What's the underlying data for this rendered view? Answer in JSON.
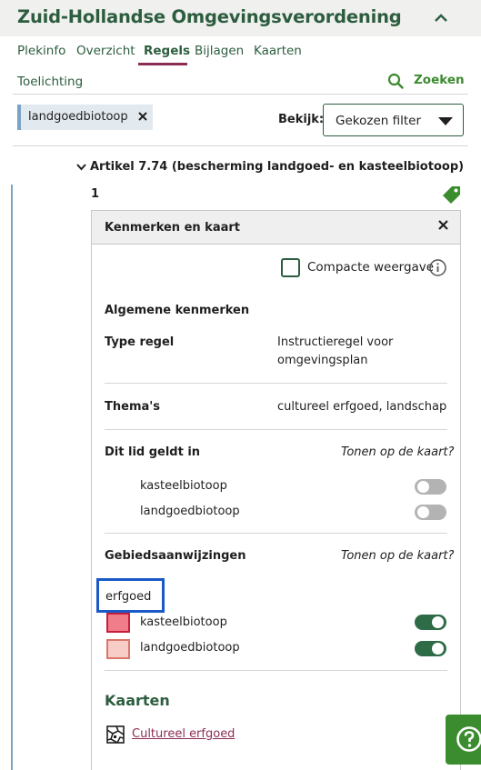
{
  "header": {
    "title": "Zuid-Hollandse Omgevingsverordening"
  },
  "tabs": [
    {
      "label": "Plekinfo"
    },
    {
      "label": "Overzicht"
    },
    {
      "label": "Regels"
    },
    {
      "label": "Bijlagen"
    },
    {
      "label": "Kaarten"
    },
    {
      "label": "Toelichting"
    }
  ],
  "active_tab": "Regels",
  "search": {
    "label": "Zoeken"
  },
  "filter_chip": {
    "label": "landgoedbiotoop"
  },
  "view": {
    "label": "Bekijk:",
    "selected": "Gekozen filter"
  },
  "artikel": {
    "title": "Artikel 7.74 (bescherming landgoed- en kasteelbiotoop)",
    "lid_number": "1"
  },
  "panel": {
    "title": "Kenmerken en kaart",
    "compact_label": "Compacte weergave",
    "compact_checked": false,
    "general_heading": "Algemene kenmerken",
    "type_label": "Type regel",
    "type_value_line1": "Instructieregel voor",
    "type_value_line2": "omgevingsplan",
    "themes_label": "Thema's",
    "themes_value": "cultureel erfgoed, landschap",
    "applies_heading": "Dit lid geldt in",
    "show_on_map": "Tonen op de kaart?",
    "applies_items": [
      {
        "label": "kasteelbiotoop",
        "on": false
      },
      {
        "label": "landgoedbiotoop",
        "on": false
      }
    ],
    "designations_heading": "Gebiedsaanwijzingen",
    "designations_show_on_map": "Tonen op de kaart?",
    "designation_group": "erfgoed",
    "designation_items": [
      {
        "label": "kasteelbiotoop",
        "on": true,
        "fill": "#f07d8a",
        "border": "#c81e3c"
      },
      {
        "label": "landgoedbiotoop",
        "on": true,
        "fill": "#f8cdc8",
        "border": "#d9776a"
      }
    ],
    "maps_heading": "Kaarten",
    "map_link": "Cultureel erfgoed"
  },
  "colors": {
    "brand_green": "#2c5d3e",
    "accent_purple": "#8b2e55",
    "action_green": "#3b8c2e",
    "focus_blue": "#1a59c6"
  },
  "icons": [
    "chevron-up-icon",
    "search-icon",
    "close-icon",
    "chevron-down-icon",
    "caret-down-icon",
    "tag-icon",
    "info-icon",
    "map-icon",
    "help-icon"
  ]
}
